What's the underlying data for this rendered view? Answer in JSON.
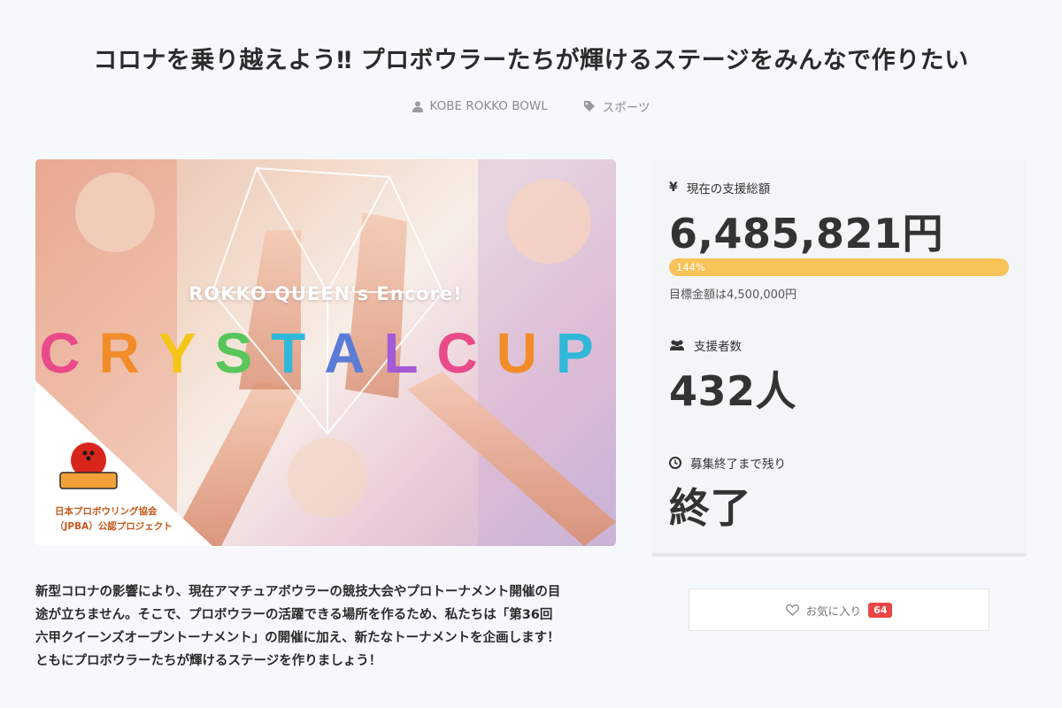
{
  "page": {
    "title": "コロナを乗り越えよう‼ プロボウラーたちが輝けるステージをみんなで作りたい"
  },
  "meta": {
    "author": "KOBE ROKKO BOWL",
    "category": "スポーツ"
  },
  "hero": {
    "subtitle": "ROKKO QUEEN's Encore!",
    "cup_letters": [
      "C",
      "R",
      "Y",
      "S",
      "T",
      "A",
      "L",
      "C",
      "U",
      "P"
    ],
    "cup_colors": [
      "#e94b8a",
      "#f28c28",
      "#f5c518",
      "#58c65a",
      "#2fb8d8",
      "#5a7bd6",
      "#a35bd6",
      "#e94b8a",
      "#f28c28",
      "#2fb8d8"
    ],
    "logo_text": "JPBA",
    "org_line1": "日本プロボウリング協会",
    "org_line2": "（JPBA）公認プロジェクト"
  },
  "stats": {
    "total_label": "現在の支援総額",
    "total_value": "6,485,821円",
    "progress_percent": 144,
    "progress_label": "144%",
    "goal_text": "目標金額は4,500,000円",
    "supporters_label": "支援者数",
    "supporters_value": "432人",
    "remaining_label": "募集終了まで残り",
    "remaining_value": "終了"
  },
  "description": {
    "line1": "新型コロナの影響により、現在アマチュアボウラーの競技大会やプロトーナメント開催の目",
    "line2": "途が立ちません。そこで、プロボウラーの活躍できる場所を作るため、私たちは「第36回",
    "line3": "六甲クイーンズオープントーナメント」の開催に加え、新たなトーナメントを企画します！",
    "line4": "ともにプロボウラーたちが輝けるステージを作りましょう！"
  },
  "favorite": {
    "label": "お気に入り",
    "count": "64"
  },
  "colors": {
    "accent_progress": "#f7c257",
    "badge": "#e84545",
    "background": "#f6f9fb"
  }
}
